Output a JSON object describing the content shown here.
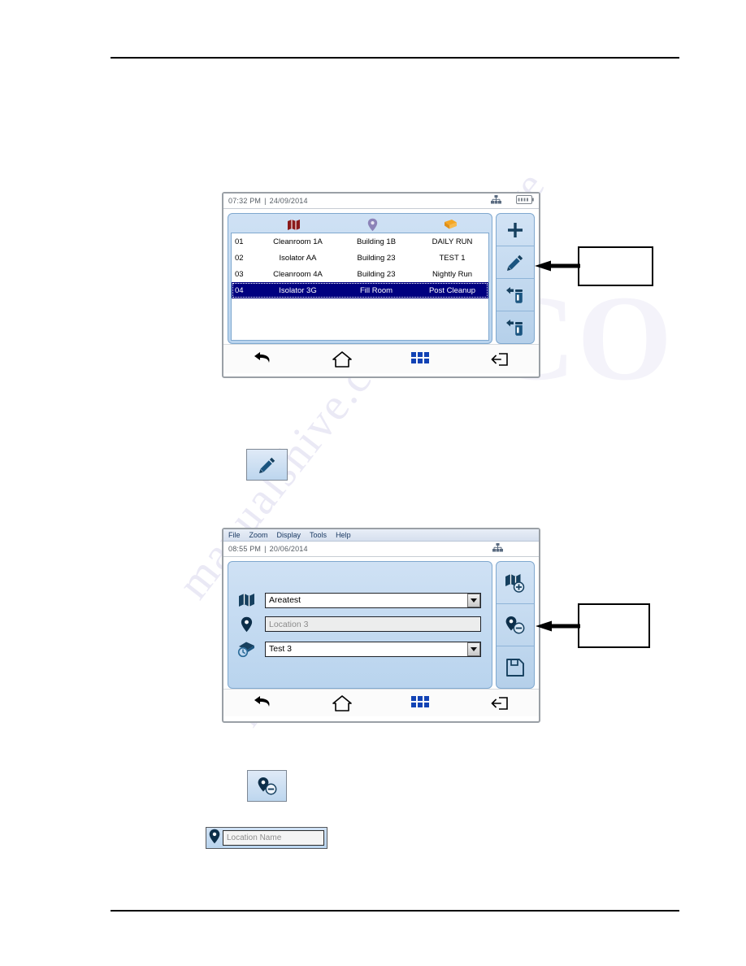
{
  "document": {
    "has_top_rule": true,
    "has_bottom_rule": true
  },
  "watermark": {
    "lines": [
      "manualshive.com",
      "manualshive",
      "CO",
      "manualshive"
    ]
  },
  "screen_one": {
    "name": "sample-list-screen",
    "status": {
      "time": "07:32 PM",
      "separator": "|",
      "date": "24/09/2014",
      "network_icon": "network-tree-icon",
      "battery_icon": "battery-icon"
    },
    "columns": [
      {
        "key": "num",
        "icon": "none"
      },
      {
        "key": "area",
        "icon": "map-icon",
        "color": "#8b1a1a"
      },
      {
        "key": "loc",
        "icon": "location-pin-icon",
        "color": "#8c83b8"
      },
      {
        "key": "test",
        "icon": "book-icon",
        "color": "#f0a020"
      }
    ],
    "rows": [
      {
        "num": "01",
        "area": "Cleanroom 1A",
        "location": "Building 1B",
        "test": "DAILY RUN",
        "selected": false
      },
      {
        "num": "02",
        "area": "Isolator AA",
        "location": "Building 23",
        "test": "TEST 1",
        "selected": false
      },
      {
        "num": "03",
        "area": "Cleanroom 4A",
        "location": "Building 23",
        "test": "Nightly Run",
        "selected": false
      },
      {
        "num": "04",
        "area": "Isolator 3G",
        "location": "Fill Room",
        "test": "Post Cleanup",
        "selected": true
      }
    ],
    "toolbar": [
      {
        "name": "add-button",
        "icon": "plus-icon"
      },
      {
        "name": "edit-button",
        "icon": "pencil-icon"
      },
      {
        "name": "assign-plate-button",
        "icon": "plate-in-icon"
      },
      {
        "name": "remove-plate-button",
        "icon": "plate-out-icon"
      }
    ],
    "nav": [
      {
        "name": "back-button",
        "icon": "back-arrow-icon"
      },
      {
        "name": "home-button",
        "icon": "home-icon"
      },
      {
        "name": "menu-button",
        "icon": "grid-icon"
      },
      {
        "name": "exit-button",
        "icon": "exit-icon"
      }
    ],
    "selection_color": "#000080"
  },
  "edit_icon_button": {
    "name": "edit-icon-button",
    "icon": "pencil-icon"
  },
  "screen_two": {
    "name": "sample-edit-screen",
    "menu": [
      "File",
      "Zoom",
      "Display",
      "Tools",
      "Help"
    ],
    "status": {
      "time": "08:55 PM",
      "separator": "|",
      "date": "20/06/2014",
      "network_icon": "network-tree-icon"
    },
    "fields": [
      {
        "name": "area-field",
        "icon": "map-icon",
        "value": "Areatest",
        "type": "combo",
        "readonly": false
      },
      {
        "name": "location-field",
        "icon": "location-pin-icon",
        "value": "Location 3",
        "type": "text",
        "readonly": true
      },
      {
        "name": "test-field",
        "icon": "test-badge-icon",
        "value": "Test 3",
        "type": "combo",
        "readonly": false
      }
    ],
    "toolbar": [
      {
        "name": "add-area-button",
        "icon": "map-plus-icon"
      },
      {
        "name": "remove-location-button",
        "icon": "pin-minus-icon"
      },
      {
        "name": "save-button",
        "icon": "floppy-save-icon"
      }
    ],
    "nav": [
      {
        "name": "back-button",
        "icon": "back-arrow-icon"
      },
      {
        "name": "home-button",
        "icon": "home-icon"
      },
      {
        "name": "menu-button",
        "icon": "grid-icon"
      },
      {
        "name": "exit-button",
        "icon": "exit-icon"
      }
    ]
  },
  "remove_location_icon_button": {
    "name": "remove-location-icon-button",
    "icon": "pin-minus-icon"
  },
  "location_name_field": {
    "name": "location-name-field",
    "icon": "location-pin-icon",
    "placeholder": "Location Name",
    "value": ""
  },
  "callouts": [
    {
      "name": "callout-box-one",
      "text": ""
    },
    {
      "name": "callout-box-two",
      "text": ""
    }
  ]
}
